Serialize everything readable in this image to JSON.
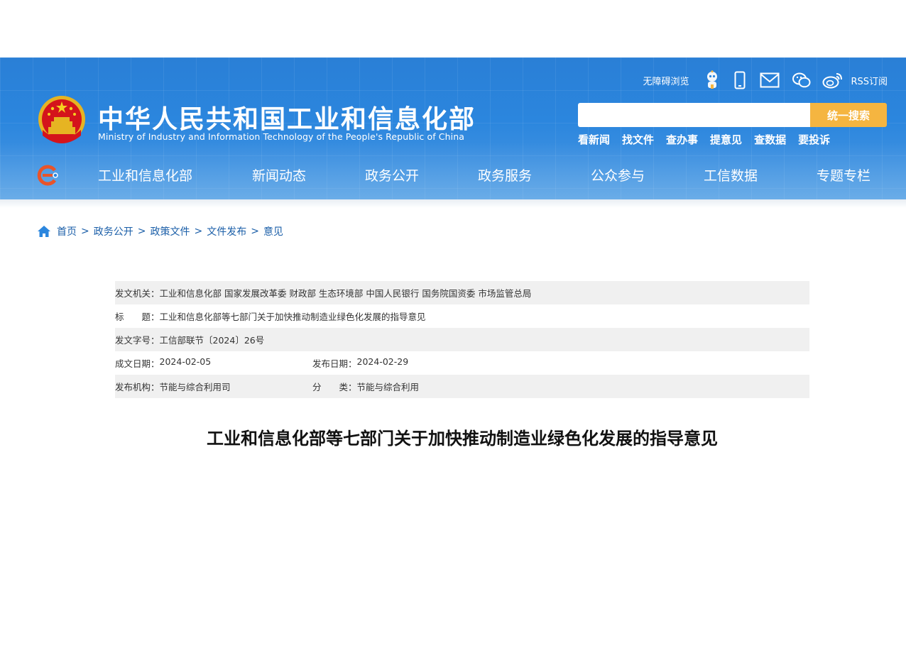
{
  "header": {
    "ministry_name_cn": "中华人民共和国工业和信息化部",
    "ministry_name_en": "Ministry of Industry and Information Technology of the People's Republic of China",
    "accessibility_label": "无障碍浏览",
    "rss_label": "RSS订阅",
    "search": {
      "placeholder": "",
      "button_label": "统一搜索"
    },
    "quick_links": [
      "看新闻",
      "找文件",
      "查办事",
      "提意见",
      "查数据",
      "要投诉"
    ],
    "colors": {
      "header_blue": "#2b86de",
      "search_button": "#f5b540"
    }
  },
  "nav": {
    "items": [
      "工业和信息化部",
      "新闻动态",
      "政务公开",
      "政务服务",
      "公众参与",
      "工信数据",
      "专题专栏"
    ]
  },
  "breadcrumb": {
    "items": [
      "首页",
      "政务公开",
      "政策文件",
      "文件发布",
      "意见"
    ],
    "separator": ">"
  },
  "meta": {
    "issuer_label": "发文机关：",
    "issuer_value": "工业和信息化部 国家发展改革委 财政部 生态环境部 中国人民银行 国务院国资委 市场监管总局",
    "title_label": "标　　题：",
    "title_value": "工业和信息化部等七部门关于加快推动制造业绿色化发展的指导意见",
    "doc_number_label": "发文字号：",
    "doc_number_value": "工信部联节〔2024〕26号",
    "written_date_label": "成文日期：",
    "written_date_value": "2024-02-05",
    "publish_date_label": "发布日期：",
    "publish_date_value": "2024-02-29",
    "publisher_label": "发布机构：",
    "publisher_value": "节能与综合利用司",
    "category_label": "分　　类：",
    "category_value": "节能与综合利用"
  },
  "document": {
    "title": "工业和信息化部等七部门关于加快推动制造业绿色化发展的指导意见"
  }
}
